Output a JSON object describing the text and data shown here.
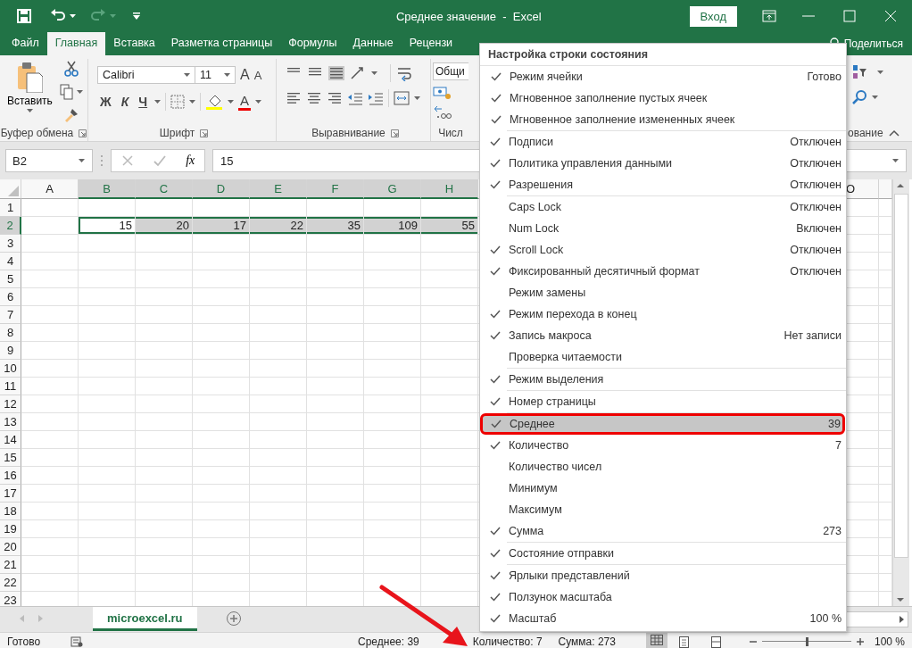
{
  "title_bar": {
    "title": "Среднее значение  -  Excel",
    "sign_in": "Вход"
  },
  "ribbon_tabs": [
    {
      "label": "Файл",
      "selected": false
    },
    {
      "label": "Главная",
      "selected": true
    },
    {
      "label": "Вставка",
      "selected": false
    },
    {
      "label": "Разметка страницы",
      "selected": false
    },
    {
      "label": "Формулы",
      "selected": false
    },
    {
      "label": "Данные",
      "selected": false
    },
    {
      "label": "Рецензи",
      "selected": false
    }
  ],
  "share": "Поделиться",
  "ribbon": {
    "paste": "Вставить",
    "font_name": "Calibri",
    "font_size": "11",
    "grow_font": "A",
    "shrink_font": "A",
    "style_buttons": [
      "Ж",
      "К",
      "Ч"
    ],
    "font_color": "A",
    "number_format": "Общи",
    "groups": [
      "Буфер обмена",
      "Шрифт",
      "Выравнивание",
      "Числ",
      "ование"
    ]
  },
  "formula_bar": {
    "name_box": "B2",
    "fx": "fx",
    "formula": "15"
  },
  "sheet": {
    "columns": [
      {
        "label": "A",
        "selected": false
      },
      {
        "label": "B",
        "selected": true
      },
      {
        "label": "C",
        "selected": true
      },
      {
        "label": "D",
        "selected": true
      },
      {
        "label": "E",
        "selected": true
      },
      {
        "label": "F",
        "selected": true
      },
      {
        "label": "G",
        "selected": true
      },
      {
        "label": "H",
        "selected": true
      },
      {
        "label": "O",
        "selected": false
      }
    ],
    "rows": [
      {
        "label": "1",
        "selected": false
      },
      {
        "label": "2",
        "selected": true,
        "cells": [
          null,
          {
            "value": "15",
            "active": true
          },
          {
            "value": "20",
            "active": false
          },
          {
            "value": "17",
            "active": false
          },
          {
            "value": "22",
            "active": false
          },
          {
            "value": "35",
            "active": false
          },
          {
            "value": "109",
            "active": false
          },
          {
            "value": "55",
            "active": false
          }
        ]
      },
      {
        "label": "3",
        "selected": false
      },
      {
        "label": "4",
        "selected": false
      },
      {
        "label": "5",
        "selected": false
      },
      {
        "label": "6",
        "selected": false
      },
      {
        "label": "7",
        "selected": false
      },
      {
        "label": "8",
        "selected": false
      },
      {
        "label": "9",
        "selected": false
      },
      {
        "label": "10",
        "selected": false
      },
      {
        "label": "11",
        "selected": false
      },
      {
        "label": "12",
        "selected": false
      },
      {
        "label": "13",
        "selected": false
      },
      {
        "label": "14",
        "selected": false
      },
      {
        "label": "15",
        "selected": false
      },
      {
        "label": "16",
        "selected": false
      },
      {
        "label": "17",
        "selected": false
      },
      {
        "label": "18",
        "selected": false
      },
      {
        "label": "19",
        "selected": false
      },
      {
        "label": "20",
        "selected": false
      },
      {
        "label": "21",
        "selected": false
      },
      {
        "label": "22",
        "selected": false
      },
      {
        "label": "23",
        "selected": false
      }
    ]
  },
  "sheet_tabs": [
    {
      "label": "microexcel.ru",
      "selected": true
    }
  ],
  "status_bar": {
    "mode": "Готово",
    "average": "Среднее: 39",
    "count": "Количество: 7",
    "sum": "Сумма: 273",
    "zoom": "100 %",
    "zoom_slider": {
      "level": 0.5
    }
  },
  "menu": {
    "title": "Настройка строки состояния",
    "sections": [
      {
        "items": [
          {
            "label": "Режим ячейки",
            "value": "Готово",
            "checked": true,
            "selected": false
          },
          {
            "label": "Мгновенное заполнение пустых ячеек",
            "checked": true,
            "selected": false
          },
          {
            "label": "Мгновенное заполнение измененных ячеек",
            "checked": true,
            "selected": false
          }
        ]
      },
      {
        "items": [
          {
            "label": "Подписи",
            "value": "Отключен",
            "checked": true,
            "selected": false
          },
          {
            "label": "Политика управления данными",
            "value": "Отключен",
            "checked": true,
            "selected": false
          },
          {
            "label": "Разрешения",
            "value": "Отключен",
            "checked": true,
            "selected": false
          }
        ]
      },
      {
        "items": [
          {
            "label": "Caps Lock",
            "value": "Отключен",
            "checked": false,
            "selected": false
          },
          {
            "label": "Num Lock",
            "value": "Включен",
            "checked": false,
            "selected": false
          },
          {
            "label": "Scroll Lock",
            "value": "Отключен",
            "checked": true,
            "selected": false
          },
          {
            "label": "Фиксированный десятичный формат",
            "value": "Отключен",
            "checked": true,
            "selected": false
          },
          {
            "label": "Режим замены",
            "checked": false,
            "selected": false
          },
          {
            "label": "Режим перехода в конец",
            "checked": true,
            "selected": false
          },
          {
            "label": "Запись макроса",
            "value": "Нет записи",
            "checked": true,
            "selected": false
          },
          {
            "label": "Проверка читаемости",
            "checked": false,
            "selected": false
          }
        ]
      },
      {
        "items": [
          {
            "label": "Режим выделения",
            "checked": true,
            "selected": false
          }
        ]
      },
      {
        "items": [
          {
            "label": "Номер страницы",
            "checked": true,
            "selected": false
          }
        ]
      },
      {
        "items": [
          {
            "label": "Среднее",
            "value": "39",
            "checked": true,
            "selected": true
          },
          {
            "label": "Количество",
            "value": "7",
            "checked": true,
            "selected": false
          },
          {
            "label": "Количество чисел",
            "checked": false,
            "selected": false
          },
          {
            "label": "Минимум",
            "checked": false,
            "selected": false
          },
          {
            "label": "Максимум",
            "checked": false,
            "selected": false
          },
          {
            "label": "Сумма",
            "value": "273",
            "checked": true,
            "selected": false
          }
        ]
      },
      {
        "items": [
          {
            "label": "Состояние отправки",
            "checked": true,
            "selected": false
          }
        ]
      },
      {
        "items": [
          {
            "label": "Ярлыки представлений",
            "checked": true,
            "selected": false
          },
          {
            "label": "Ползунок масштаба",
            "checked": true,
            "selected": false
          },
          {
            "label": "Масштаб",
            "value": "100 %",
            "checked": true,
            "selected": false
          }
        ]
      }
    ]
  }
}
